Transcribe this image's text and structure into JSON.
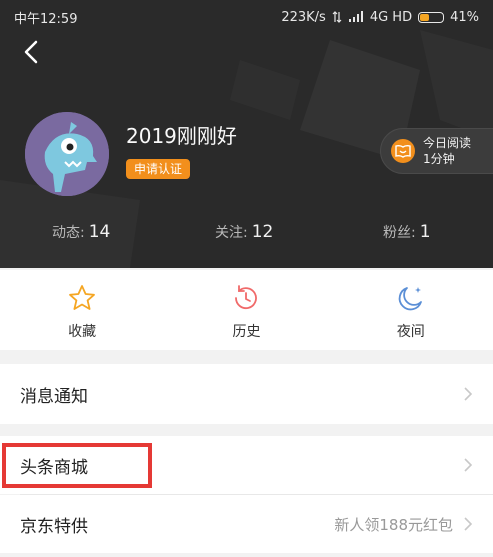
{
  "status_bar": {
    "time": "中午12:59",
    "speed": "223K/s",
    "network": "4G HD",
    "battery": "41%"
  },
  "profile": {
    "username": "2019刚刚好",
    "verify_label": "申请认证",
    "reading": {
      "line1": "今日阅读",
      "line2": "1分钟"
    },
    "stats": [
      {
        "label": "动态:",
        "value": "14"
      },
      {
        "label": "关注:",
        "value": "12"
      },
      {
        "label": "粉丝:",
        "value": "1"
      }
    ]
  },
  "quick_actions": [
    {
      "label": "收藏",
      "icon": "star-icon"
    },
    {
      "label": "历史",
      "icon": "history-icon"
    },
    {
      "label": "夜间",
      "icon": "night-icon"
    }
  ],
  "menu": {
    "notifications": {
      "label": "消息通知"
    },
    "mall": {
      "label": "头条商城"
    },
    "jd": {
      "label": "京东特供",
      "hint": "新人领188元红包"
    }
  },
  "colors": {
    "accent": "#f28f1c",
    "highlight": "#e53935"
  }
}
